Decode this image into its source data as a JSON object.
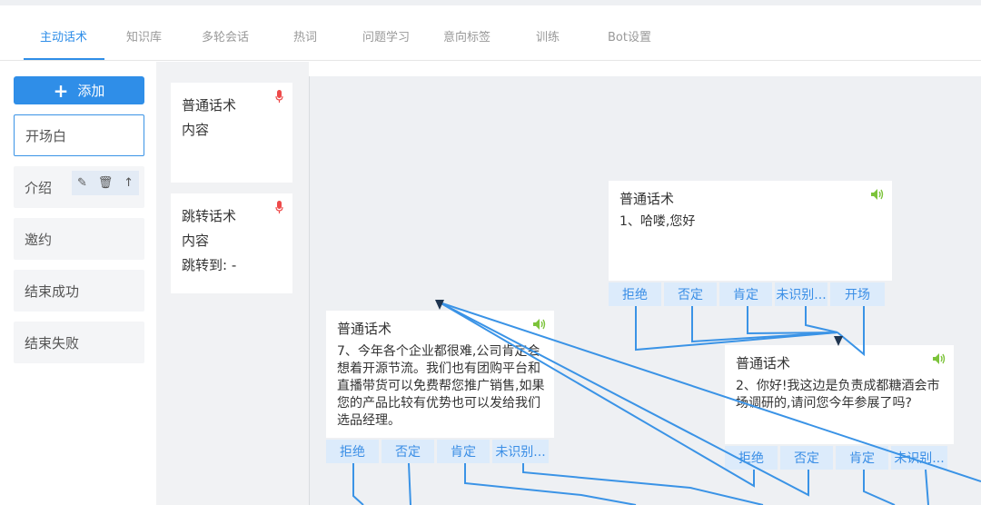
{
  "tabs": [
    "主动话术",
    "知识库",
    "多轮会话",
    "热词",
    "问题学习",
    "意向标签",
    "训练",
    "Bot设置"
  ],
  "add_button": "添加",
  "categories": [
    "开场白",
    "介绍",
    "邀约",
    "结束成功",
    "结束失败"
  ],
  "category_tools": [
    "✎",
    "🗑",
    "↑"
  ],
  "templates": [
    {
      "title": "普通话术",
      "content": "内容"
    },
    {
      "title": "跳转话术",
      "content": "内容",
      "jump": "跳转到: -"
    }
  ],
  "nodes": [
    {
      "title": "普通话术",
      "text": "1、哈喽,您好",
      "buttons": [
        "拒绝",
        "否定",
        "肯定",
        "未识别...",
        "开场"
      ]
    },
    {
      "title": "普通话术",
      "text": "7、今年各个企业都很难,公司肯定会想着开源节流。我们也有团购平台和直播带货可以免费帮您推广销售,如果您的产品比较有优势也可以发给我们选品经理。",
      "buttons": [
        "拒绝",
        "否定",
        "肯定",
        "未识别..."
      ]
    },
    {
      "title": "普通话术",
      "text": "2、你好!我这边是负责成都糖酒会市场调研的,请问您今年参展了吗?",
      "buttons": [
        "拒绝",
        "否定",
        "肯定",
        "未识别..."
      ]
    }
  ],
  "colors": {
    "accent": "#2f8ee8",
    "button_bg": "#dcebfb",
    "speaker": "#7cc33a",
    "mic": "#ee4a4a"
  }
}
